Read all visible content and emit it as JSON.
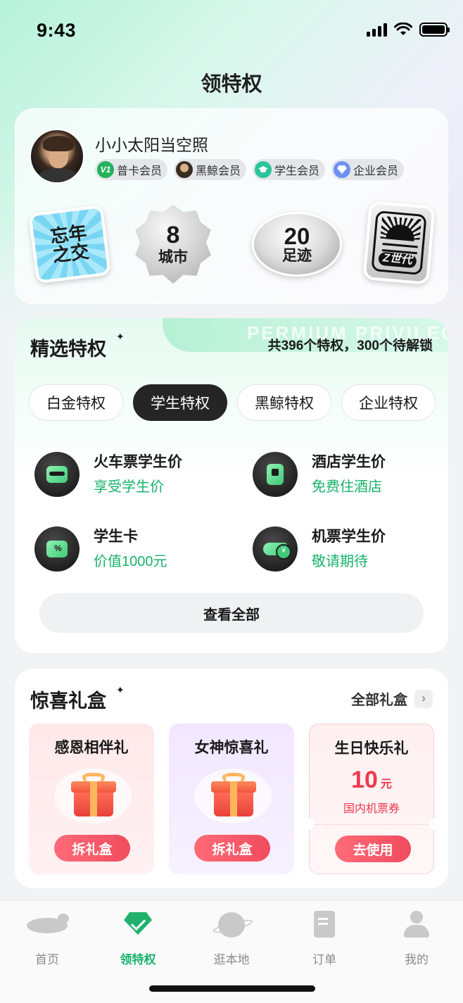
{
  "status_bar": {
    "time": "9:43"
  },
  "header": {
    "title": "领特权"
  },
  "profile": {
    "username": "小小太阳当空照",
    "badges": [
      {
        "icon": "v1-icon",
        "icon_text": "V1",
        "label": "普卡会员"
      },
      {
        "icon": "black-whale-icon",
        "label": "黑鲸会员"
      },
      {
        "icon": "student-cap-icon",
        "label": "学生会员"
      },
      {
        "icon": "diamond-icon",
        "label": "企业会员"
      }
    ],
    "stickers": [
      {
        "line1": "忘年",
        "line2": "之交"
      },
      {
        "line1": "8",
        "line2": "城市"
      },
      {
        "line1": "20",
        "line2": "足迹"
      },
      {
        "line1": "Z世代"
      }
    ]
  },
  "privileges": {
    "title": "精选特权",
    "watermark": "PERMIUM PRIVILEGE",
    "count_text": "共396个特权，300个待解锁",
    "tabs": [
      {
        "label": "白金特权",
        "active": false
      },
      {
        "label": "学生特权",
        "active": true
      },
      {
        "label": "黑鲸特权",
        "active": false
      },
      {
        "label": "企业特权",
        "active": false
      }
    ],
    "items": [
      {
        "icon": "train-icon",
        "name": "火车票学生价",
        "sub": "享受学生价"
      },
      {
        "icon": "hotel-icon",
        "name": "酒店学生价",
        "sub": "免费住酒店"
      },
      {
        "icon": "student-card-icon",
        "name": "学生卡",
        "sub": "价值1000元"
      },
      {
        "icon": "plane-ticket-icon",
        "name": "机票学生价",
        "sub": "敬请期待"
      }
    ],
    "view_all": "查看全部"
  },
  "gifts": {
    "title": "惊喜礼盒",
    "all_label": "全部礼盒",
    "boxes": [
      {
        "title": "感恩相伴礼",
        "button": "拆礼盒"
      },
      {
        "title": "女神惊喜礼",
        "button": "拆礼盒"
      },
      {
        "title": "生日快乐礼",
        "amount": "10",
        "unit": "元",
        "desc": "国内机票券",
        "button": "去使用"
      }
    ]
  },
  "bottom_nav": [
    {
      "label": "首页",
      "icon": "blimp-home-icon",
      "active": false
    },
    {
      "label": "领特权",
      "icon": "privilege-diamond-icon",
      "active": true
    },
    {
      "label": "逛本地",
      "icon": "planet-icon",
      "active": false
    },
    {
      "label": "订单",
      "icon": "order-document-icon",
      "active": false
    },
    {
      "label": "我的",
      "icon": "user-icon",
      "active": false
    }
  ],
  "colors": {
    "accent_green": "#18b26b",
    "gift_red": "#f04c5e",
    "dark_tab": "#252525"
  }
}
